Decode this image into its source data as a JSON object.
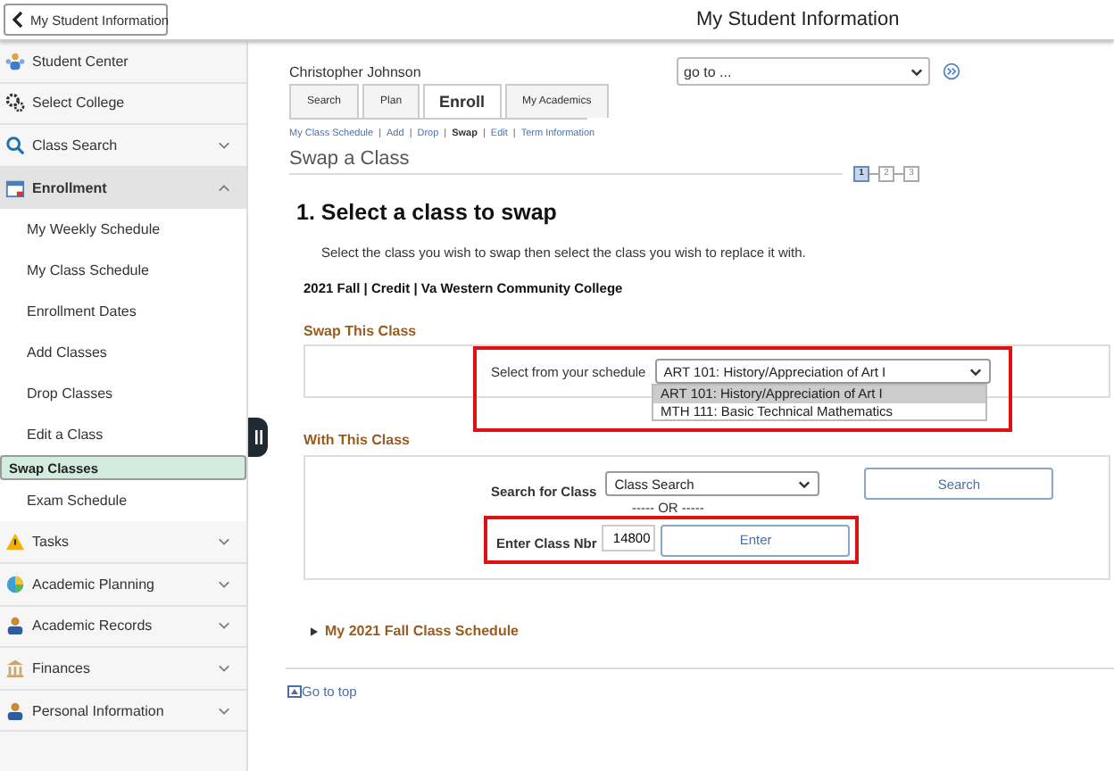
{
  "header": {
    "back_button": "My Student Information",
    "title": "My Student Information"
  },
  "sidebar": {
    "items": [
      {
        "label": "Student Center"
      },
      {
        "label": "Select College"
      },
      {
        "label": "Class Search",
        "expanded": false
      },
      {
        "label": "Enrollment",
        "expanded": true,
        "children": [
          {
            "label": "My Weekly Schedule",
            "selected": false
          },
          {
            "label": "My Class Schedule",
            "selected": false
          },
          {
            "label": "Enrollment Dates",
            "selected": false
          },
          {
            "label": "Add Classes",
            "selected": false
          },
          {
            "label": "Drop Classes",
            "selected": false
          },
          {
            "label": "Edit a Class",
            "selected": false
          },
          {
            "label": "Swap Classes",
            "selected": true
          },
          {
            "label": "Exam Schedule",
            "selected": false
          }
        ]
      },
      {
        "label": "Tasks",
        "expanded": false
      },
      {
        "label": "Academic Planning",
        "expanded": false
      },
      {
        "label": "Academic Records",
        "expanded": false
      },
      {
        "label": "Finances",
        "expanded": false
      },
      {
        "label": "Personal Information",
        "expanded": false
      }
    ]
  },
  "student_name": "Christopher Johnson",
  "goto": {
    "value": "go to ..."
  },
  "tabs": [
    {
      "label": "Search",
      "selected": false
    },
    {
      "label": "Plan",
      "selected": false
    },
    {
      "label": "Enroll",
      "selected": true
    },
    {
      "label": "My Academics",
      "selected": false
    }
  ],
  "subnav": {
    "separator": "|",
    "links": [
      {
        "label": "My Class Schedule",
        "selected": false
      },
      {
        "label": "Add",
        "selected": false
      },
      {
        "label": "Drop",
        "selected": false
      },
      {
        "label": "Swap",
        "selected": true
      },
      {
        "label": "Edit",
        "selected": false
      },
      {
        "label": "Term Information",
        "selected": false
      }
    ]
  },
  "page_title": "Swap a Class",
  "steps": [
    {
      "label": "1",
      "selected": true
    },
    {
      "label": "2",
      "selected": false
    },
    {
      "label": "3",
      "selected": false
    }
  ],
  "heading": "1.  Select a class to swap",
  "instructions": "Select the class you wish to swap then select the class you wish to replace it with.",
  "term": "2021 Fall | Credit | Va Western Community College",
  "swap_this_class": {
    "title": "Swap This Class",
    "label": "Select from your schedule",
    "value": "ART 101: History/Appreciation of Art I",
    "options": [
      {
        "label": "ART 101: History/Appreciation of Art I",
        "selected": true
      },
      {
        "label": "MTH 111: Basic Technical Mathematics",
        "selected": false
      }
    ]
  },
  "with_this_class": {
    "title": "With This Class",
    "search_label": "Search for Class",
    "search_value": "Class Search",
    "search_button": "Search",
    "separator": "----- OR -----",
    "class_nbr_label": "Enter Class Nbr",
    "class_nbr_value": "14800",
    "enter_button": "Enter"
  },
  "schedule_toggle": {
    "label": "My 2021 Fall Class Schedule",
    "expanded": false
  },
  "go_to_top": "Go to top"
}
